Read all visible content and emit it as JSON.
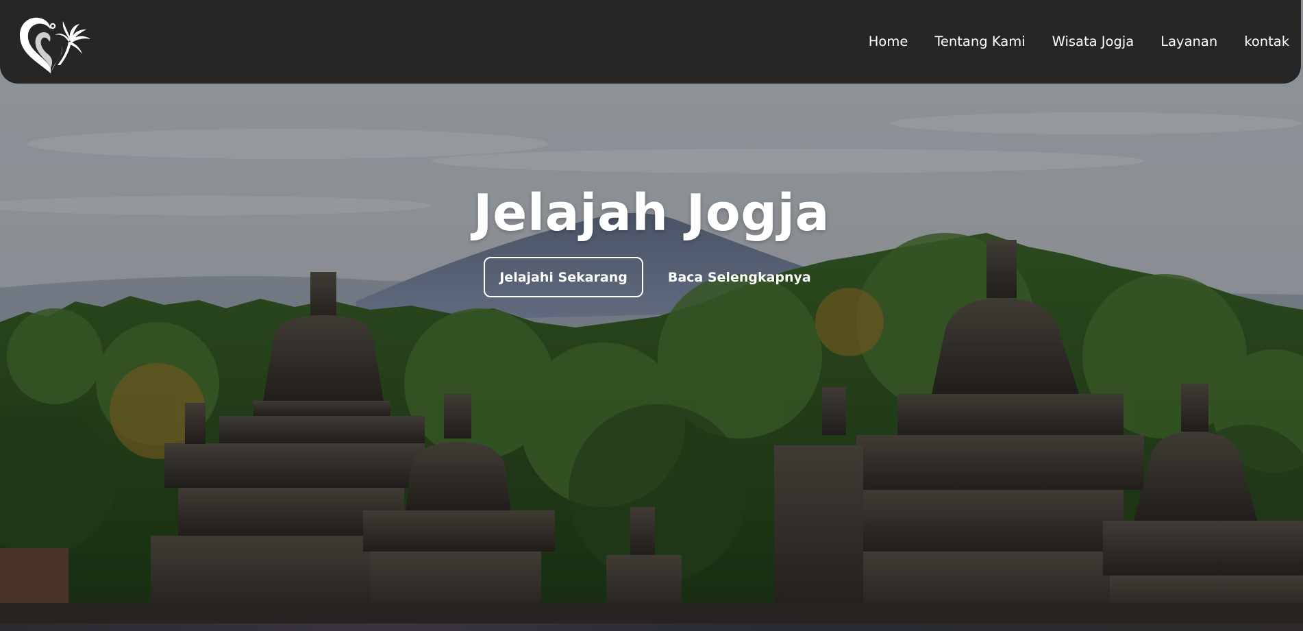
{
  "colors": {
    "navbar_bg": "#262626",
    "text": "#ffffff",
    "overlay": "rgba(0,0,0,0.30)"
  },
  "navbar": {
    "logo_icon": "heart-palm-logo-icon",
    "links": [
      {
        "label": "Home"
      },
      {
        "label": "Tentang Kami"
      },
      {
        "label": "Wisata Jogja"
      },
      {
        "label": "Layanan"
      },
      {
        "label": "kontak"
      }
    ]
  },
  "hero": {
    "title": "Jelajah Jogja",
    "primary_button": "Jelajahi Sekarang",
    "secondary_button": "Baca Selengkapnya"
  }
}
